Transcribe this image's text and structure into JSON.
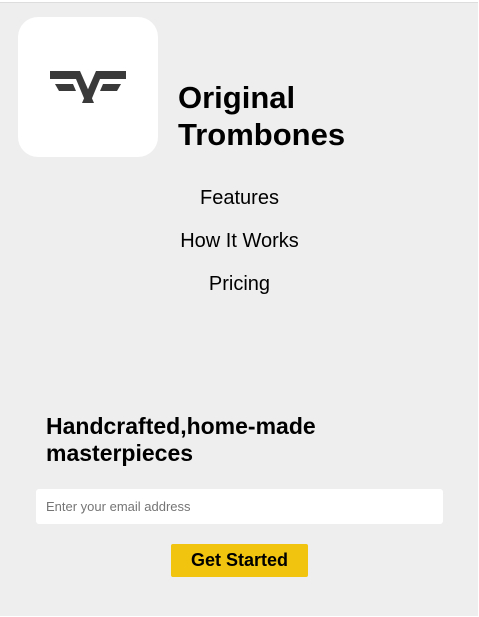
{
  "brand": {
    "logo_icon": "winged-v-logo-icon",
    "logo_color": "#3a3a3a",
    "name_line1": "Original",
    "name_line2": "Trombones"
  },
  "nav": {
    "items": [
      {
        "label": "Features"
      },
      {
        "label": "How It Works"
      },
      {
        "label": "Pricing"
      }
    ]
  },
  "hero": {
    "headline_line1": "Handcrafted,home-made",
    "headline_line2": "masterpieces",
    "email_placeholder": "Enter your email address",
    "email_value": "",
    "cta_label": "Get Started",
    "cta_color": "#f1c40f"
  },
  "colors": {
    "background": "#eeeeee",
    "card": "#ffffff",
    "text": "#000000"
  }
}
